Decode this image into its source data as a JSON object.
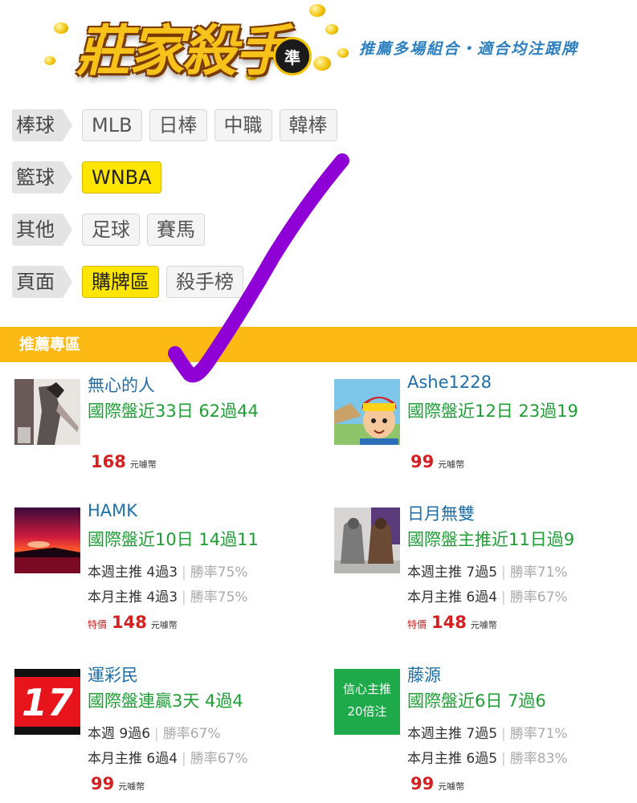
{
  "header": {
    "logo_text": "莊家殺手",
    "logo_badge": "準",
    "tagline": "推薦多場組合・適合均注跟牌"
  },
  "categories": [
    {
      "label": "棒球",
      "chips": [
        {
          "text": "MLB",
          "active": false
        },
        {
          "text": "日棒",
          "active": false
        },
        {
          "text": "中職",
          "active": false
        },
        {
          "text": "韓棒",
          "active": false
        }
      ]
    },
    {
      "label": "籃球",
      "chips": [
        {
          "text": "WNBA",
          "active": true
        }
      ]
    },
    {
      "label": "其他",
      "chips": [
        {
          "text": "足球",
          "active": false
        },
        {
          "text": "賽馬",
          "active": false
        }
      ]
    },
    {
      "label": "頁面",
      "chips": [
        {
          "text": "購牌區",
          "active": true
        },
        {
          "text": "殺手榜",
          "active": false
        }
      ]
    }
  ],
  "section": {
    "title": "推薦專區"
  },
  "cards": [
    {
      "name": "無心的人",
      "record": "國際盤近33日 62過44",
      "lines": [],
      "promo": "",
      "price": "168",
      "unit": "元噱幣",
      "avatar": "warrior-art"
    },
    {
      "name": "Ashe1228",
      "record": "國際盤近12日 23過19",
      "lines": [],
      "promo": "",
      "price": "99",
      "unit": "元噱幣",
      "avatar": "cartoon-boy"
    },
    {
      "name": "HAMK",
      "record": "國際盤近10日 14過11",
      "lines": [
        {
          "text": "本週主推 4過3",
          "rate": "勝率75%"
        },
        {
          "text": "本月主推 4過3",
          "rate": "勝率75%"
        }
      ],
      "promo": "特價",
      "price": "148",
      "unit": "元噱幣",
      "avatar": "sunset"
    },
    {
      "name": "日月無雙",
      "record": "國際盤主推近11日過9",
      "lines": [
        {
          "text": "本週主推 7過5",
          "rate": "勝率71%"
        },
        {
          "text": "本月主推 6過4",
          "rate": "勝率67%"
        }
      ],
      "promo": "特價",
      "price": "148",
      "unit": "元噱幣",
      "avatar": "figurines"
    },
    {
      "name": "運彩民",
      "record": "國際盤連贏3天 4過4",
      "lines": [
        {
          "text": "本週 9過6",
          "rate": "勝率67%"
        },
        {
          "text": "本月主推 6過4",
          "rate": "勝率67%"
        }
      ],
      "promo": "",
      "price": "99",
      "unit": "元噱幣",
      "avatar": "number-17",
      "avatar_text": "17"
    },
    {
      "name": "藤源",
      "record": "國際盤近6日 7過6",
      "lines": [
        {
          "text": "本週主推 7過5",
          "rate": "勝率71%"
        },
        {
          "text": "本月主推 6過5",
          "rate": "勝率83%"
        }
      ],
      "promo": "",
      "price": "99",
      "unit": "元噱幣",
      "avatar": "green-badge",
      "avatar_lines": [
        "信心主推",
        "20倍注"
      ]
    }
  ],
  "colors": {
    "accent": "#fdb913",
    "name": "#1f6fa8",
    "record": "#1e9e35",
    "price": "#d42020",
    "active_chip": "#ffe500",
    "check": "#8f00d6"
  }
}
